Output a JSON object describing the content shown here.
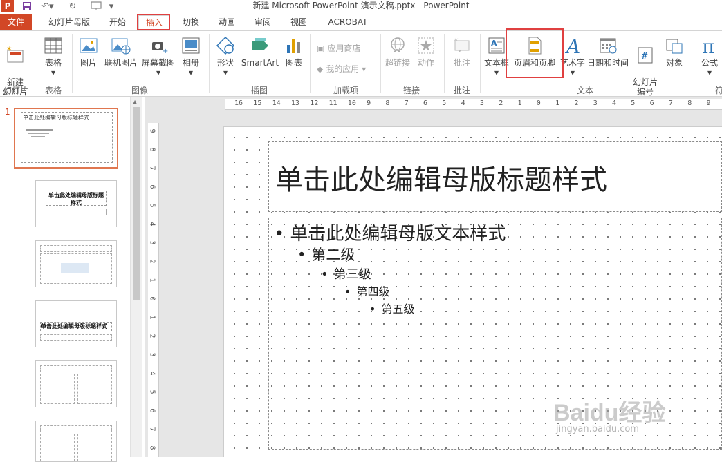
{
  "window": {
    "app_logo": "P",
    "title": "新建 Microsoft PowerPoint 演示文稿.pptx - PowerPoint"
  },
  "tabs": [
    {
      "label": "文件"
    },
    {
      "label": "幻灯片母版"
    },
    {
      "label": "开始"
    },
    {
      "label": "插入"
    },
    {
      "label": "切换"
    },
    {
      "label": "动画"
    },
    {
      "label": "审阅"
    },
    {
      "label": "视图"
    },
    {
      "label": "ACROBAT"
    }
  ],
  "ribbon": {
    "new_slide": "新建\n幻灯片",
    "table": "表格",
    "picture": "图片",
    "online_picture": "联机图片",
    "screenshot": "屏幕截图",
    "album": "相册",
    "shape": "形状",
    "smartart": "SmartArt",
    "chart": "图表",
    "app_store": "应用商店",
    "my_apps": "我的应用",
    "hyperlink": "超链接",
    "action": "动作",
    "comment": "批注",
    "textbox": "文本框",
    "header_footer": "页眉和页脚",
    "wordart": "艺术字",
    "datetime": "日期和时间",
    "slide_number": "幻灯片\n编号",
    "object": "对象",
    "equation": "公式",
    "groups": {
      "slides": "幻灯片",
      "tables": "表格",
      "images": "图像",
      "illustrations": "插图",
      "addins": "加载项",
      "links": "链接",
      "comments": "批注",
      "text": "文本",
      "symbols": "符"
    }
  },
  "thumbnails": {
    "first_number": "1",
    "master_title": "单击此处编辑母版标题样式",
    "layout_title": "单击此处编辑母版标题样式"
  },
  "ruler": {
    "horizontal": [
      "16",
      "15",
      "14",
      "13",
      "12",
      "11",
      "10",
      "9",
      "8",
      "7",
      "6",
      "5",
      "4",
      "3",
      "2",
      "1",
      "0",
      "1",
      "2",
      "3",
      "4",
      "5",
      "6",
      "7",
      "8",
      "9"
    ],
    "vertical": [
      "9",
      "8",
      "7",
      "6",
      "5",
      "4",
      "3",
      "2",
      "1",
      "0",
      "1",
      "2",
      "3",
      "4",
      "5",
      "6",
      "7",
      "8"
    ]
  },
  "slide": {
    "title": "单击此处编辑母版标题样式",
    "levels": [
      "单击此处编辑母版文本样式",
      "第二级",
      "第三级",
      "第四级",
      "第五级"
    ]
  },
  "watermark": {
    "brand": "Baidu经验",
    "url": "jingyan.baidu.com"
  },
  "colors": {
    "accent": "#d24726",
    "highlight_box": "#e04040"
  }
}
